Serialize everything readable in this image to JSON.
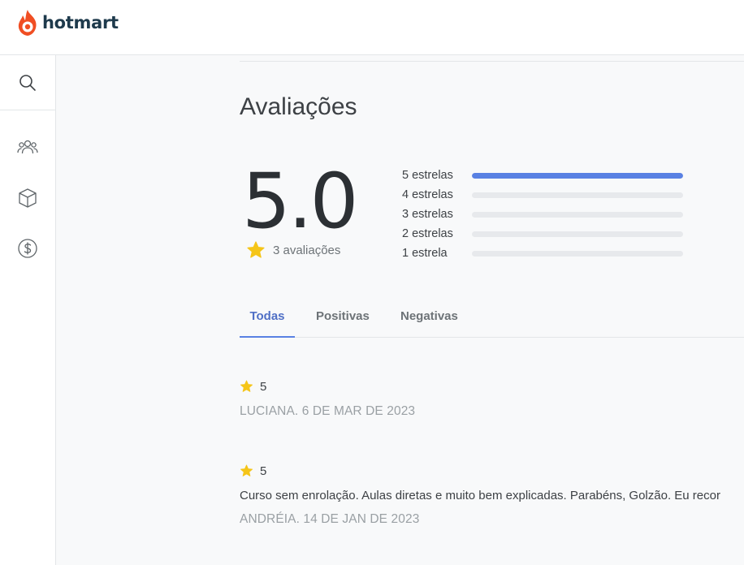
{
  "brand": {
    "name": "hotmart",
    "color": "#f04e23"
  },
  "colors": {
    "accent": "#5981e3",
    "star": "#f5c518"
  },
  "sidebar": {
    "items": [
      {
        "icon": "search-icon"
      },
      {
        "icon": "users-icon"
      },
      {
        "icon": "box-icon"
      },
      {
        "icon": "dollar-icon"
      }
    ]
  },
  "page": {
    "title": "Avaliações"
  },
  "summary": {
    "score": "5.0",
    "count_label": "3 avaliações",
    "distribution": [
      {
        "label": "5 estrelas",
        "fraction": 1.0
      },
      {
        "label": "4 estrelas",
        "fraction": 0.0
      },
      {
        "label": "3 estrelas",
        "fraction": 0.0
      },
      {
        "label": "2 estrelas",
        "fraction": 0.0
      },
      {
        "label": "1 estrela",
        "fraction": 0.0
      }
    ]
  },
  "tabs": [
    {
      "label": "Todas",
      "active": true
    },
    {
      "label": "Positivas",
      "active": false
    },
    {
      "label": "Negativas",
      "active": false
    }
  ],
  "reviews": [
    {
      "rating": "5",
      "text": "",
      "author": "LUCIANA. 6 DE MAR DE 2023"
    },
    {
      "rating": "5",
      "text": "Curso sem enrolação. Aulas diretas e muito bem explicadas. Parabéns, Golzão. Eu recor",
      "author": "ANDRÉIA. 14 DE JAN DE 2023"
    }
  ]
}
